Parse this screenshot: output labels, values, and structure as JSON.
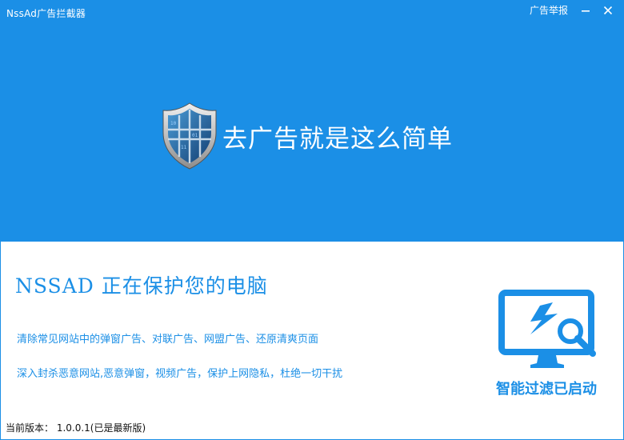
{
  "window": {
    "title": "NssAd广告拦截器",
    "report_label": "广告举报"
  },
  "hero": {
    "slogan": "去广告就是这么简单"
  },
  "main": {
    "protect_text": "NSSAD 正在保护您的电脑",
    "desc_line1": "清除常见网站中的弹窗广告、对联广告、网盟广告、还原清爽页面",
    "desc_line2": "深入封杀恶意网站,恶意弹窗，视频广告，保护上网隐私，杜绝一切干扰",
    "status_text": "智能过滤已启动"
  },
  "footer": {
    "version_text": "当前版本： 1.0.0.1(已是最新版)"
  },
  "icons": {
    "shield": "shield-icon",
    "monitor": "monitor-search-icon",
    "minimize": "minimize-icon",
    "close": "close-icon"
  },
  "colors": {
    "accent": "#1b8fe6",
    "background": "#ffffff"
  }
}
